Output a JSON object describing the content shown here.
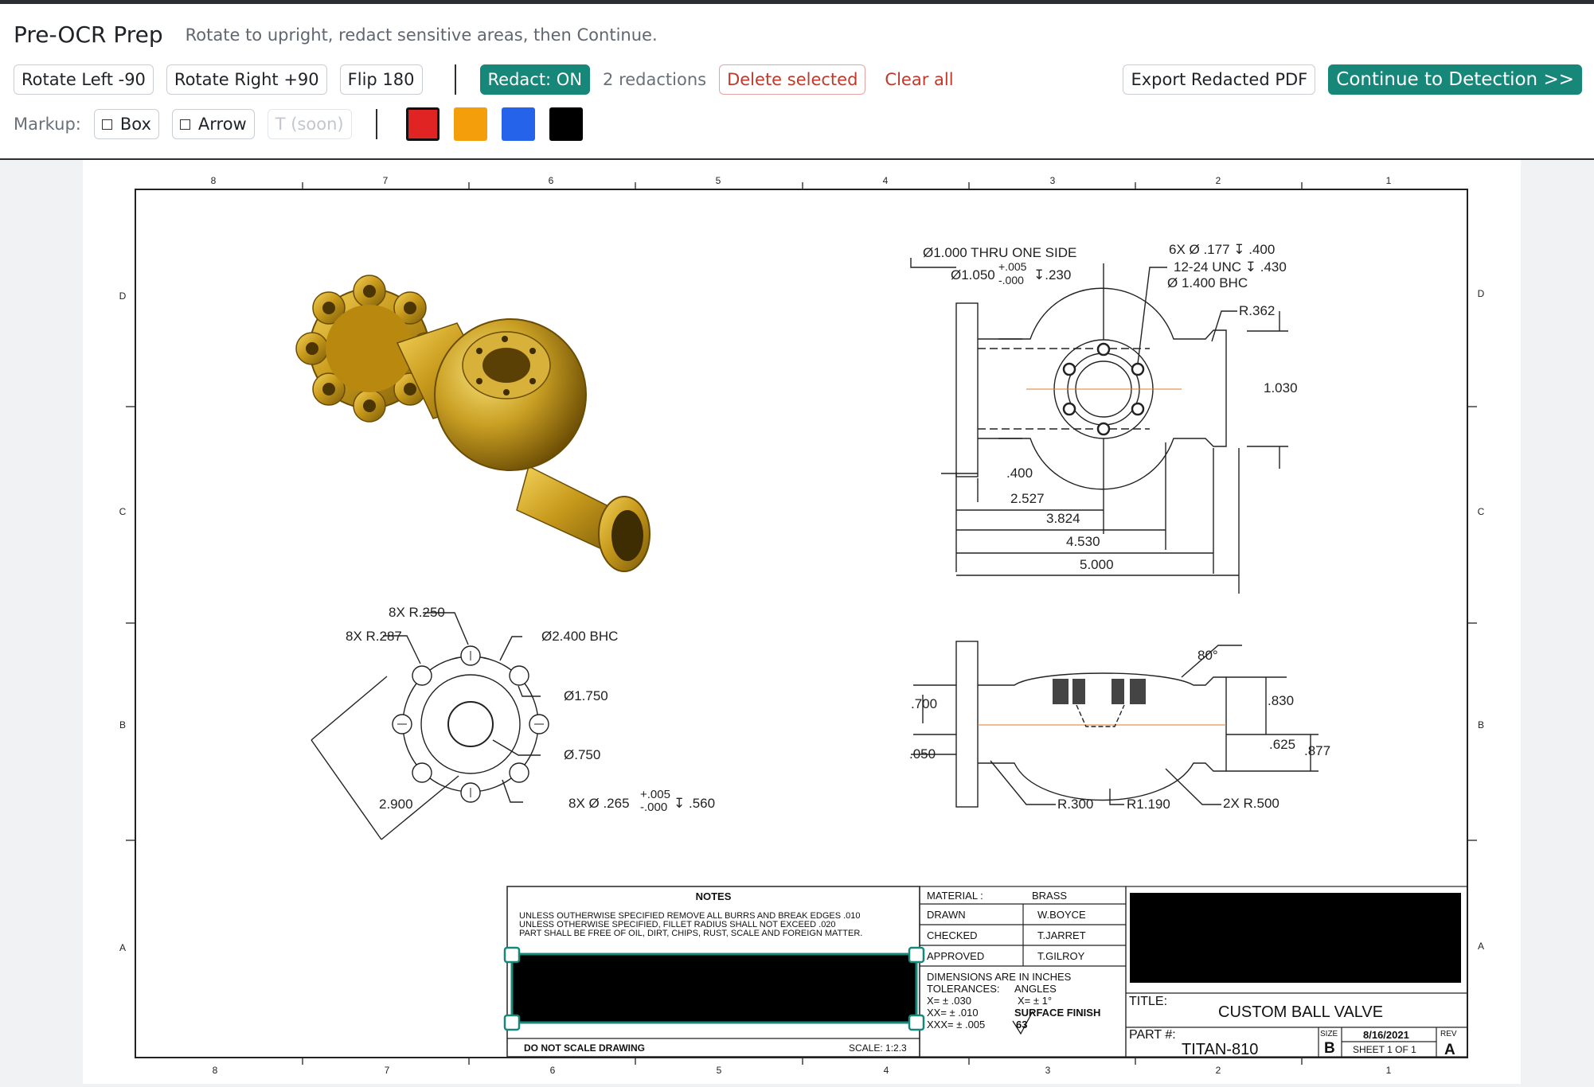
{
  "app": {
    "title": "Pre-OCR Prep",
    "subtitle": "Rotate to upright, redact sensitive areas, then Continue."
  },
  "toolbar": {
    "rotate_left": "Rotate Left  -90",
    "rotate_right": "Rotate Right  +90",
    "flip": "Flip 180",
    "redact": "Redact: ON",
    "redaction_count": "2 redactions",
    "delete_selected": "Delete selected",
    "clear_all": "Clear all",
    "export": "Export Redacted PDF",
    "continue": "Continue to Detection  >>"
  },
  "markup": {
    "label": "Markup:",
    "box": "Box",
    "arrow": "Arrow",
    "text_tool": "T  (soon)",
    "colors": [
      "#e02424",
      "#f59e0b",
      "#2563eb",
      "#000000"
    ],
    "selected_color": "#e02424"
  },
  "drawing": {
    "zone_cols": [
      "8",
      "7",
      "6",
      "5",
      "4",
      "3",
      "2",
      "1"
    ],
    "zone_rows": [
      "D",
      "C",
      "B",
      "A"
    ],
    "top_view": {
      "callout_thru": "Ø1.000 THRU ONE SIDE",
      "callout_cbore": "Ø1.050",
      "callout_cbore_tol_plus": "+.005",
      "callout_cbore_tol_minus": "-.000",
      "callout_cbore_depth": "↧.230",
      "callout_holes_1": "6X  Ø .177  ↧ .400",
      "callout_holes_2": "12-24 UNC  ↧ .430",
      "callout_holes_3": "Ø  1.400 BHC",
      "radius": "R.362",
      "height": "1.030",
      "dim_400": ".400",
      "dim_2527": "2.527",
      "dim_3824": "3.824",
      "dim_4530": "4.530",
      "dim_5000": "5.000"
    },
    "side_view": {
      "angle": "80°",
      "dim_830": ".830",
      "dim_700": ".700",
      "dim_625": ".625",
      "dim_877": ".877",
      "dim_050": ".050",
      "r300": "R.300",
      "r1190": "R1.190",
      "r500": "2X R.500"
    },
    "flange_view": {
      "r250": "8X R.250",
      "r287": "8X R.287",
      "bhc": "Ø2.400 BHC",
      "d1750": "Ø1.750",
      "d750": "Ø.750",
      "holes": "8X  Ø  .265",
      "holes_tol_plus": "+.005",
      "holes_tol_minus": "-.000",
      "holes_depth": "↧ .560",
      "across": "2.900"
    },
    "notes": {
      "heading": "NOTES",
      "line1": "UNLESS OUTHERWISE SPECIFIED REMOVE ALL BURRS AND BREAK EDGES .010",
      "line2": "UNLESS OTHERWISE SPECIFIED, FILLET RADIUS SHALL NOT EXCEED .020",
      "line3": "PART SHALL BE FREE OF OIL, DIRT, CHIPS, RUST, SCALE AND FOREIGN MATTER.",
      "do_not_scale": "DO NOT SCALE DRAWING",
      "scale": "SCALE: 1:2.3"
    },
    "info": {
      "material_label": "MATERIAL :",
      "material": "BRASS",
      "drawn_label": "DRAWN",
      "drawn": "W.BOYCE",
      "checked_label": "CHECKED",
      "checked": "T.JARRET",
      "approved_label": "APPROVED",
      "approved": "T.GILROY",
      "dims_note": "DIMENSIONS ARE IN INCHES",
      "tolerances": "TOLERANCES:",
      "angles": "ANGLES",
      "tol_x": "X= ± .030",
      "tol_angle": "X= ± 1°",
      "tol_xx": "XX= ± .010",
      "surface_finish": "SURFACE FINISH",
      "tol_xxx": "XXX= ± .005",
      "finish_value": "63"
    },
    "title_block": {
      "title_label": "TITLE:",
      "title": "CUSTOM BALL VALVE",
      "part_label": "PART #:",
      "part": "TITAN-810",
      "size_label": "SIZE",
      "size": "B",
      "date": "8/16/2021",
      "sheet": "SHEET 1 OF 1",
      "rev_label": "REV",
      "rev": "A"
    }
  }
}
